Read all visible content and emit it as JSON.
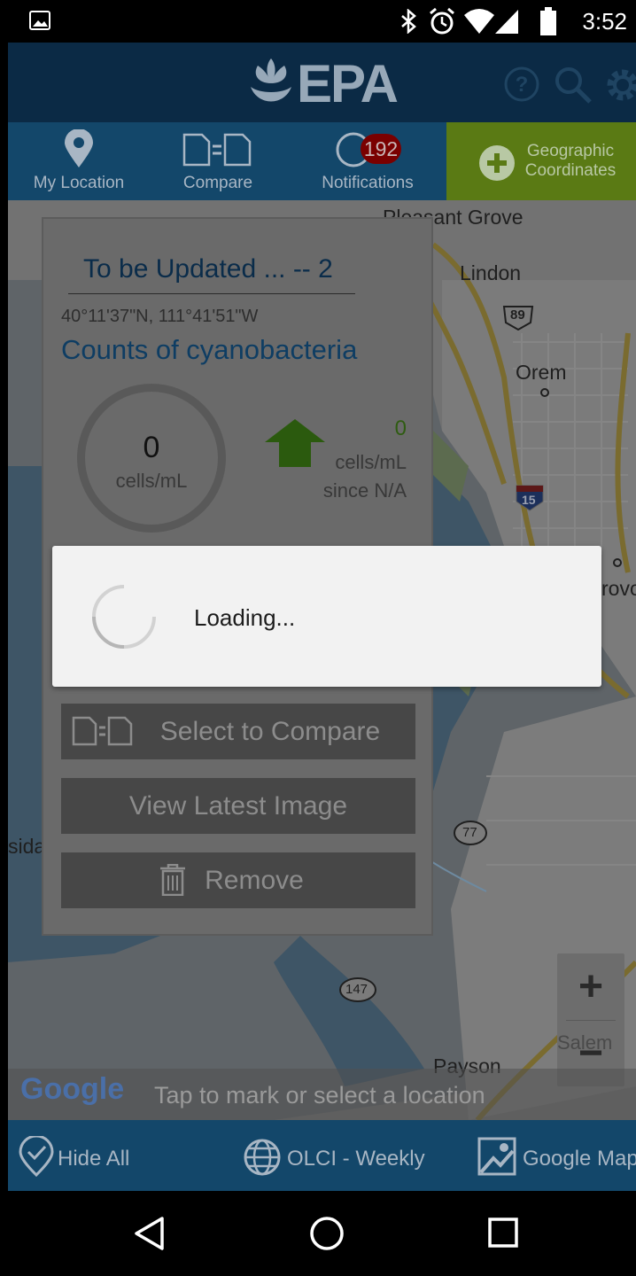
{
  "status_bar": {
    "time": "3:52",
    "icons": [
      "image-icon",
      "bluetooth-icon",
      "alarm-icon",
      "wifi-icon",
      "signal-icon",
      "battery-icon"
    ]
  },
  "header": {
    "logo_text": "EPA",
    "icons": [
      "help-icon",
      "search-icon",
      "settings-icon"
    ]
  },
  "tabs": [
    {
      "label": "My Location",
      "icon": "location-pin-icon"
    },
    {
      "label": "Compare",
      "icon": "compare-icon"
    },
    {
      "label": "Notifications",
      "icon": "bell-icon",
      "badge": "192"
    },
    {
      "label": "Geographic\nCoordinates",
      "icon": "plus-circle-icon"
    }
  ],
  "map": {
    "labels": {
      "pleasant_grove": "Pleasant Grove",
      "lindon": "Lindon",
      "orem": "Orem",
      "provo_partial": "rovo",
      "payson": "Payson",
      "salem": "Salem",
      "lakeside_partial": "sida"
    },
    "route_shields": {
      "us89": "89",
      "i15": "15",
      "r77": "77",
      "r147": "147"
    },
    "google_logo": "Google",
    "zoom": {
      "in": "+",
      "out": "−"
    }
  },
  "card": {
    "title": "To be Updated ... -- 2",
    "coordinates": "40°11'37\"N, 111°41'51\"W",
    "heading": "Counts of cyanobacteria",
    "count_value": "0",
    "count_unit": "cells/mL",
    "change_value": "0",
    "change_unit": "cells/mL",
    "change_since": "since N/A",
    "buttons": {
      "compare": "Select to Compare",
      "view": "View Latest Image",
      "remove": "Remove"
    },
    "colors": {
      "title": "#0a2c4a",
      "heading": "#0e3d63",
      "arrow": "#2b5a0e"
    }
  },
  "dialog": {
    "message": "Loading..."
  },
  "hint": {
    "text": "Tap to mark or select a location"
  },
  "bottom_bar": {
    "hide_all": "Hide All",
    "layer": "OLCI - Weekly",
    "map_type": "Google Map"
  },
  "colors": {
    "header": "#0b2a45",
    "tabbar": "#13476a",
    "geo_tab": "#5a7a14",
    "badge": "#7a0000"
  }
}
